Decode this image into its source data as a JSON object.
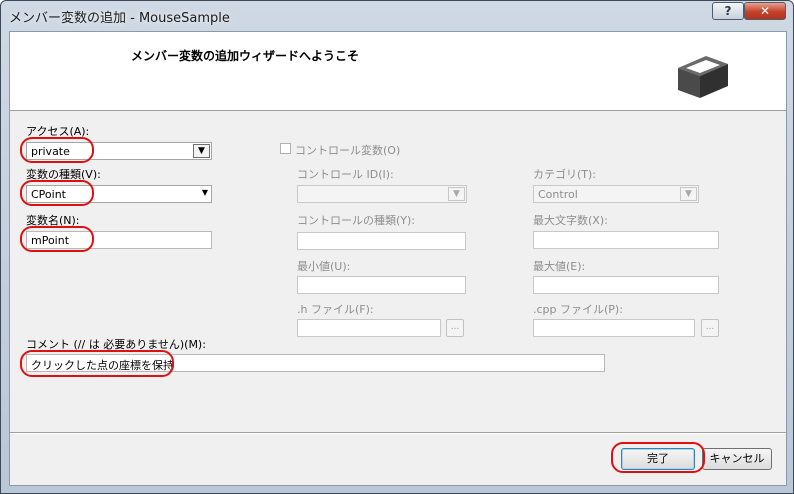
{
  "window": {
    "title": "メンバー変数の追加 - MouseSample",
    "help_label": "?",
    "close_label": "✕"
  },
  "header": {
    "title": "メンバー変数の追加ウィザードへようこそ",
    "logo_icon": "wizard-box-icon"
  },
  "form": {
    "access": {
      "label": "アクセス(A):",
      "value": "private"
    },
    "var_type": {
      "label": "変数の種類(V):",
      "value": "CPoint"
    },
    "var_name": {
      "label": "変数名(N):",
      "value": "mPoint"
    },
    "control_var": {
      "label": "コントロール変数(O)",
      "checked": false
    },
    "control_id": {
      "label": "コントロール ID(I):",
      "value": ""
    },
    "category": {
      "label": "カテゴリ(T):",
      "value": "Control"
    },
    "control_type": {
      "label": "コントロールの種類(Y):",
      "value": ""
    },
    "max_chars": {
      "label": "最大文字数(X):",
      "value": ""
    },
    "min_value": {
      "label": "最小値(U):",
      "value": ""
    },
    "max_value": {
      "label": "最大値(E):",
      "value": ""
    },
    "h_file": {
      "label": ".h ファイル(F):",
      "value": "",
      "browse_label": "..."
    },
    "cpp_file": {
      "label": ".cpp ファイル(P):",
      "value": "",
      "browse_label": "..."
    },
    "comment": {
      "label": "コメント (// は 必要ありません)(M):",
      "value": "クリックした点の座標を保持"
    }
  },
  "buttons": {
    "finish": "完了",
    "cancel": "キャンセル"
  },
  "highlight_color": "#dd1111"
}
